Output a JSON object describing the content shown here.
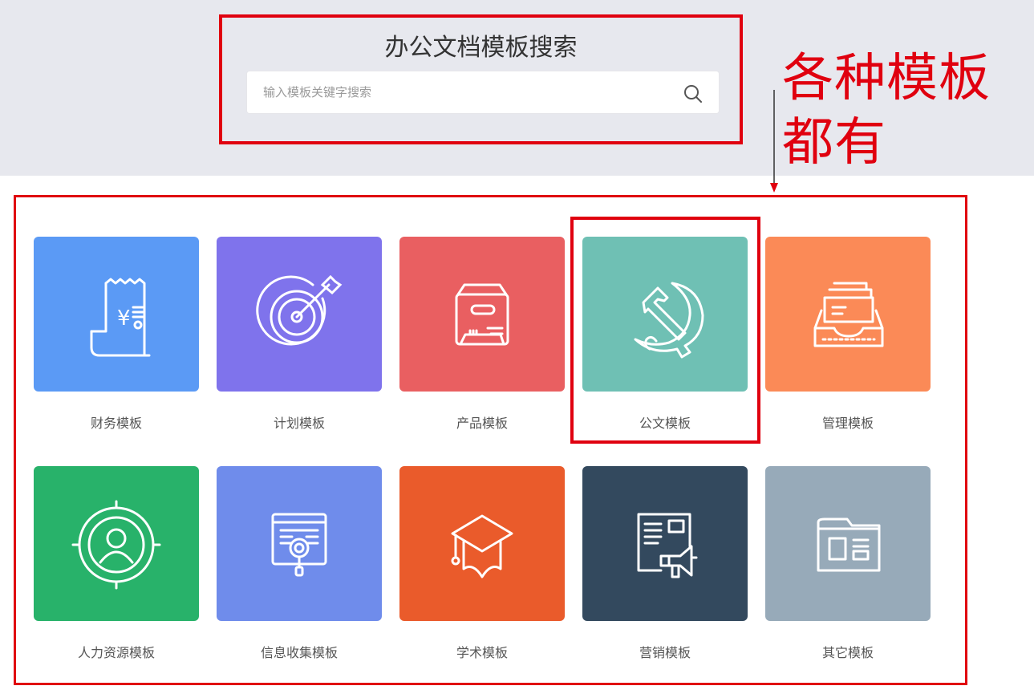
{
  "search": {
    "title": "办公文档模板搜索",
    "placeholder": "输入模板关键字搜索",
    "value": ""
  },
  "annotation": {
    "line1": "各种模板",
    "line2": "都有"
  },
  "categories": [
    {
      "label": "财务模板",
      "icon": "receipt-yen-icon",
      "color": "#5b9af5"
    },
    {
      "label": "计划模板",
      "icon": "target-arrow-icon",
      "color": "#7f73ec"
    },
    {
      "label": "产品模板",
      "icon": "product-box-icon",
      "color": "#e95f61"
    },
    {
      "label": "公文模板",
      "icon": "hammer-sickle-icon",
      "color": "#6fc0b4"
    },
    {
      "label": "管理模板",
      "icon": "file-tray-icon",
      "color": "#fb8a57"
    },
    {
      "label": "人力资源模板",
      "icon": "person-target-icon",
      "color": "#28b26a"
    },
    {
      "label": "信息收集模板",
      "icon": "info-search-icon",
      "color": "#6f8ceb"
    },
    {
      "label": "学术模板",
      "icon": "graduation-cap-icon",
      "color": "#ea5b2b"
    },
    {
      "label": "营销模板",
      "icon": "megaphone-board-icon",
      "color": "#33495e"
    },
    {
      "label": "其它模板",
      "icon": "folder-doc-icon",
      "color": "#97aab9"
    }
  ]
}
